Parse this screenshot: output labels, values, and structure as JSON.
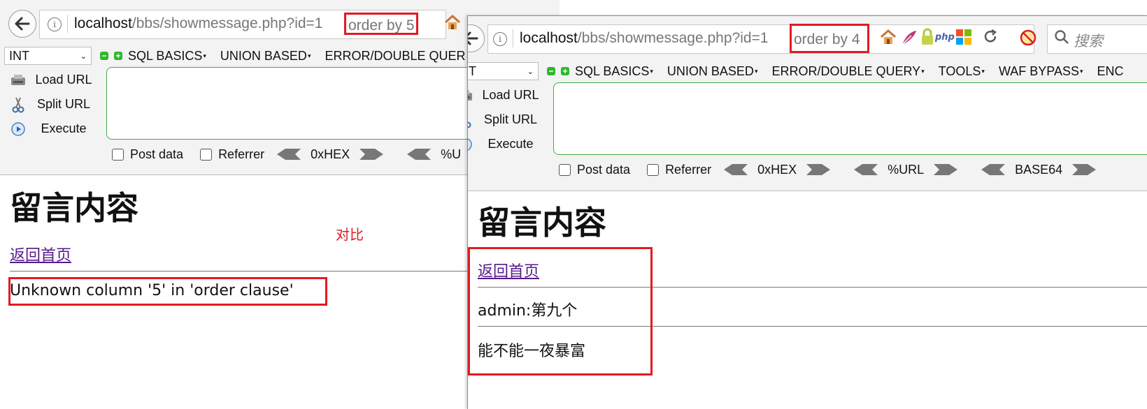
{
  "windowA": {
    "url_host": "localhost",
    "url_path": "/bbs/showmessage.php?id=1",
    "url_highlight": "order by 5",
    "select_value": "INT",
    "menus": [
      "SQL BASICS",
      "UNION BASED",
      "ERROR/DOUBLE QUER"
    ],
    "sidebar": [
      "Load URL",
      "Split URL",
      "Execute"
    ],
    "bottom": {
      "post_data": "Post data",
      "referrer": "Referrer",
      "hex": "0xHEX",
      "url_enc": "%U"
    },
    "heading": "留言内容",
    "home_link": "返回首页",
    "error": "Unknown column '5' in 'order clause'"
  },
  "annotation": "对比",
  "windowB": {
    "url_host": "localhost",
    "url_path": "/bbs/showmessage.php?id=1",
    "url_highlight": "order by 4",
    "search_placeholder": "搜索",
    "select_value": "INT",
    "menus": [
      "SQL BASICS",
      "UNION BASED",
      "ERROR/DOUBLE QUERY",
      "TOOLS",
      "WAF BYPASS",
      "ENC"
    ],
    "sidebar": [
      "Load URL",
      "Split URL",
      "Execute"
    ],
    "bottom": {
      "post_data": "Post data",
      "referrer": "Referrer",
      "hex": "0xHEX",
      "url_enc": "%URL",
      "base64": "BASE64"
    },
    "heading": "留言内容",
    "home_link": "返回首页",
    "messages": [
      "admin:第九个",
      "能不能一夜暴富"
    ]
  },
  "colors": {
    "highlight": "#e01b24",
    "visited_link": "#551a8b",
    "green": "#2eb82e"
  }
}
